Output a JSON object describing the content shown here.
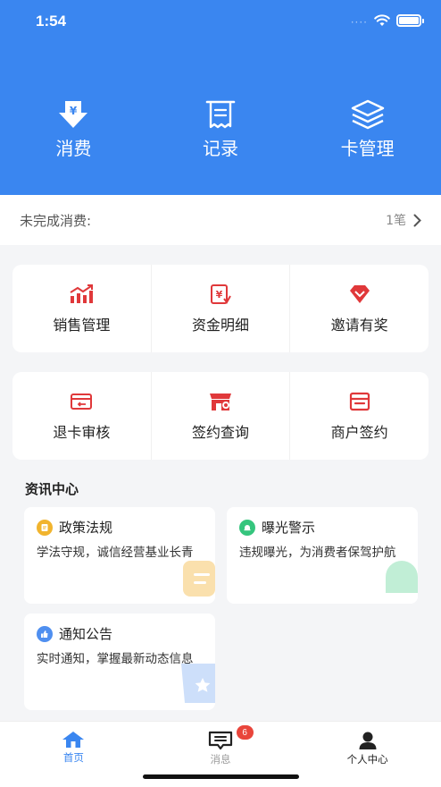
{
  "status_bar": {
    "time": "1:54"
  },
  "top_actions": [
    {
      "label": "消费",
      "icon": "yuan-download-icon"
    },
    {
      "label": "记录",
      "icon": "receipt-icon"
    },
    {
      "label": "卡管理",
      "icon": "layers-icon"
    }
  ],
  "pending": {
    "label": "未完成消费:",
    "count": "1笔"
  },
  "grid_row1": [
    {
      "label": "销售管理",
      "icon": "sales-chart-icon"
    },
    {
      "label": "资金明细",
      "icon": "fund-detail-icon"
    },
    {
      "label": "邀请有奖",
      "icon": "diamond-gift-icon"
    }
  ],
  "grid_row2": [
    {
      "label": "退卡审核",
      "icon": "card-return-icon"
    },
    {
      "label": "签约查询",
      "icon": "store-search-icon"
    },
    {
      "label": "商户签约",
      "icon": "merchant-sign-icon"
    }
  ],
  "news": {
    "section_title": "资讯中心",
    "items": [
      {
        "title": "政策法规",
        "desc": "学法守规，诚信经营基业长青",
        "icon": "policy-icon"
      },
      {
        "title": "曝光警示",
        "desc": "违规曝光，为消费者保驾护航",
        "icon": "bell-icon"
      },
      {
        "title": "通知公告",
        "desc": "实时通知，掌握最新动态信息",
        "icon": "thumbs-up-icon"
      }
    ]
  },
  "tabbar": {
    "items": [
      {
        "label": "首页",
        "icon": "home-icon"
      },
      {
        "label": "消息",
        "icon": "message-icon",
        "badge": "6"
      },
      {
        "label": "个人中心",
        "icon": "user-icon"
      }
    ]
  },
  "colors": {
    "primary": "#3a86f0",
    "accent_red": "#e0383a",
    "badge": "#e9453b"
  }
}
